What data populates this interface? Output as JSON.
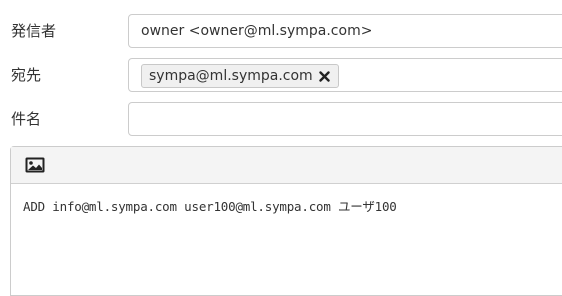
{
  "form": {
    "from_label": "発信者",
    "from_value": "owner <owner@ml.sympa.com>",
    "to_label": "宛先",
    "to_recipients": [
      {
        "address": "sympa@ml.sympa.com",
        "remove_icon": "close-icon"
      }
    ],
    "subject_label": "件名",
    "subject_value": ""
  },
  "editor": {
    "toolbar": {
      "insert_image_icon": "image-icon"
    },
    "body_text": "ADD info@ml.sympa.com user100@ml.sympa.com ユーザ100"
  }
}
